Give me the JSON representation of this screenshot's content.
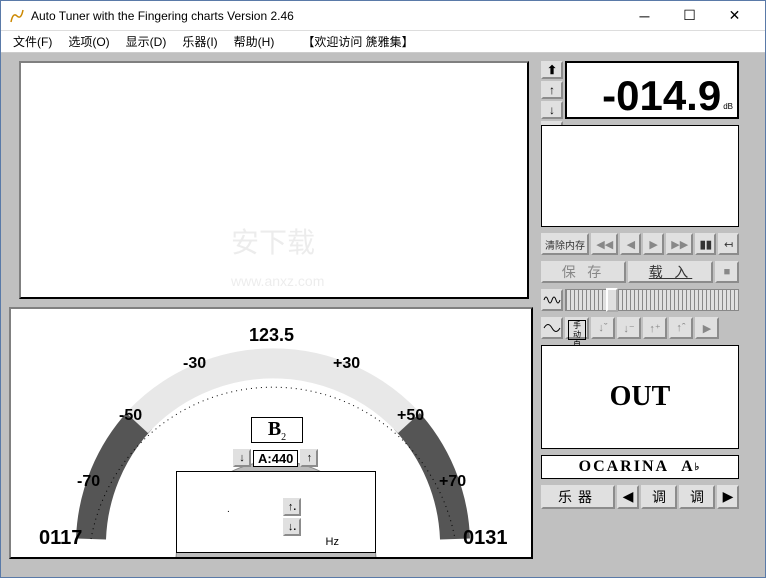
{
  "titlebar": {
    "title": "Auto Tuner with the Fingering charts  Version 2.46"
  },
  "menu": {
    "file": "文件(F)",
    "options": "选项(O)",
    "display": "显示(D)",
    "instrument": "乐器(I)",
    "help": "帮助(H)",
    "welcome": "【欢迎访问 篪雅集】"
  },
  "readout": {
    "value": "-014.9",
    "unit": "dB"
  },
  "controls": {
    "clear_mem": "清除内存",
    "save": "保 存",
    "load": "载 入",
    "manual": "手 动",
    "auto": "自 动"
  },
  "out_panel": {
    "text": "OUT"
  },
  "instrument_panel": {
    "name": "OCARINA",
    "key": "A",
    "accidental": "♭"
  },
  "bottom_buttons": {
    "instrument": "乐器",
    "tune": "调",
    "tune2": "调"
  },
  "gauge": {
    "top_value": "123.5",
    "left_value": "0117",
    "right_value": "0131",
    "ticks": [
      "-70",
      "-50",
      "-30",
      "+30",
      "+50",
      "+70"
    ],
    "note": "B",
    "note_octave": "2",
    "ref_label": "A:440",
    "hz_unit": "Hz"
  }
}
